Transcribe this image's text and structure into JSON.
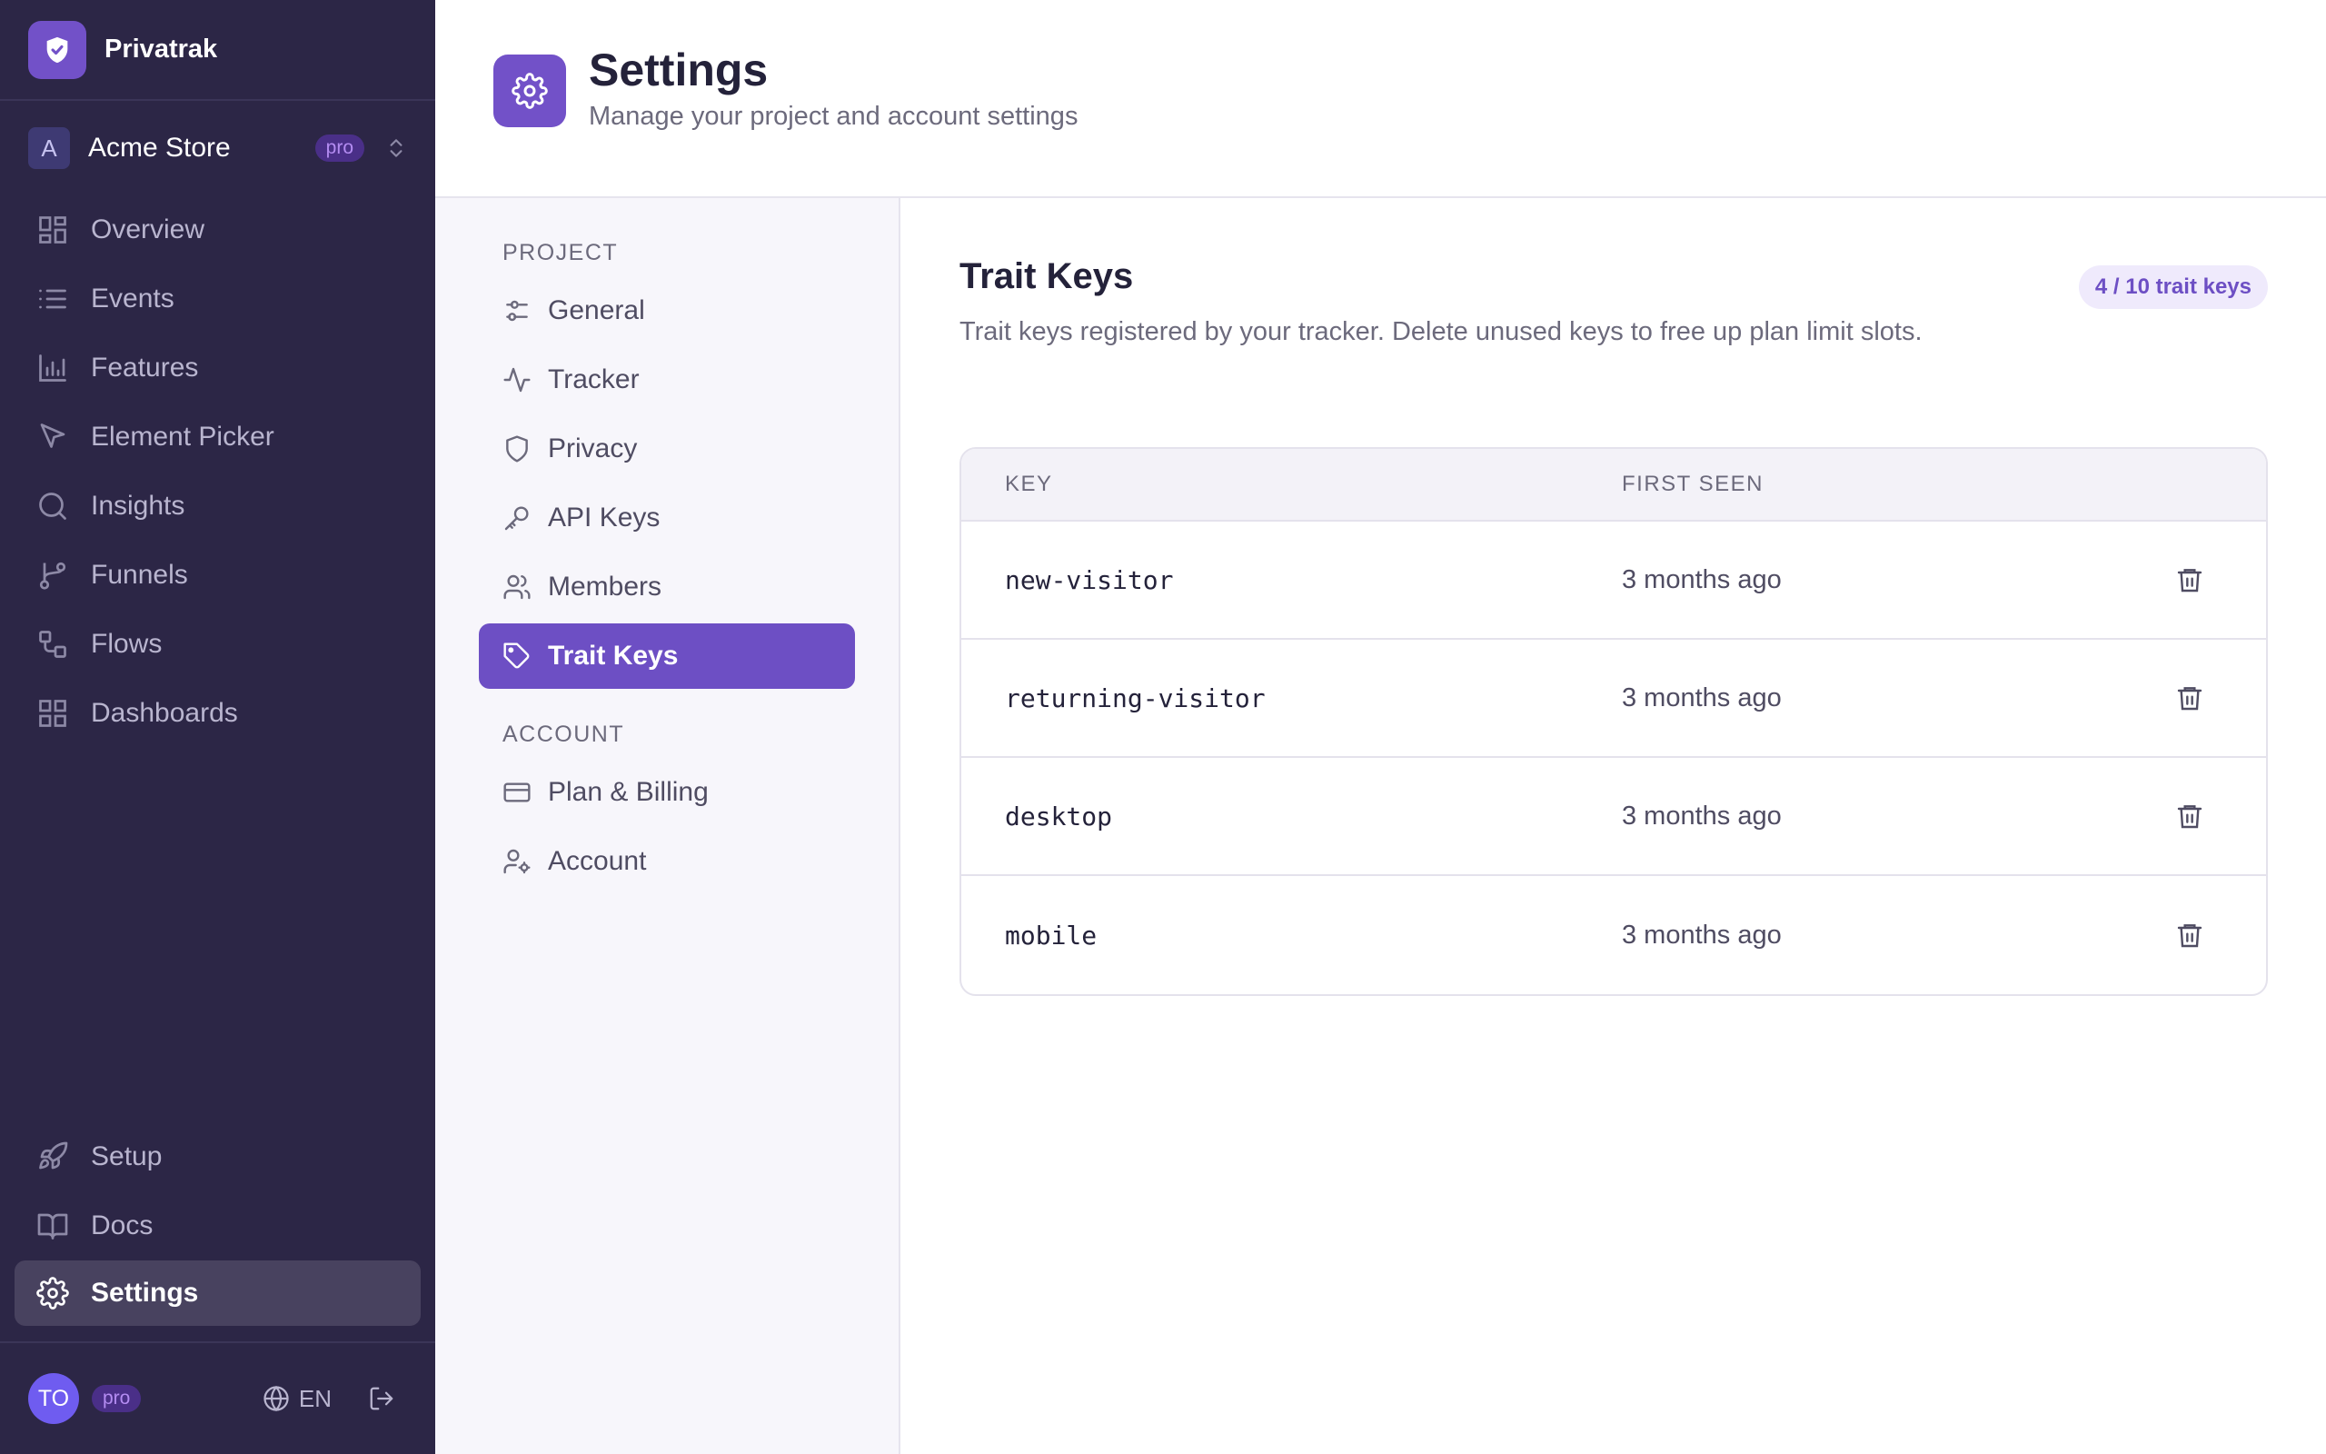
{
  "brand": {
    "name": "Privatrak"
  },
  "project": {
    "avatar": "A",
    "name": "Acme Store",
    "plan": "pro"
  },
  "sidebar": {
    "items": [
      {
        "label": "Overview",
        "icon": "grid-icon"
      },
      {
        "label": "Events",
        "icon": "list-icon"
      },
      {
        "label": "Features",
        "icon": "bar-chart-icon"
      },
      {
        "label": "Element Picker",
        "icon": "cursor-icon"
      },
      {
        "label": "Insights",
        "icon": "search-icon"
      },
      {
        "label": "Funnels",
        "icon": "branch-icon"
      },
      {
        "label": "Flows",
        "icon": "flow-icon"
      },
      {
        "label": "Dashboards",
        "icon": "dashboard-icon"
      }
    ],
    "bottom_items": [
      {
        "label": "Setup",
        "icon": "rocket-icon"
      },
      {
        "label": "Docs",
        "icon": "book-icon"
      },
      {
        "label": "Settings",
        "icon": "gear-icon",
        "active": true
      }
    ]
  },
  "footer": {
    "user_initials": "TO",
    "plan": "pro",
    "language": "EN"
  },
  "header": {
    "title": "Settings",
    "subtitle": "Manage your project and account settings"
  },
  "subnav": {
    "project_label": "PROJECT",
    "project_items": [
      {
        "label": "General",
        "icon": "sliders-icon"
      },
      {
        "label": "Tracker",
        "icon": "activity-icon"
      },
      {
        "label": "Privacy",
        "icon": "shield-icon"
      },
      {
        "label": "API Keys",
        "icon": "key-icon"
      },
      {
        "label": "Members",
        "icon": "users-icon"
      },
      {
        "label": "Trait Keys",
        "icon": "tag-icon",
        "active": true
      }
    ],
    "account_label": "ACCOUNT",
    "account_items": [
      {
        "label": "Plan & Billing",
        "icon": "credit-card-icon"
      },
      {
        "label": "Account",
        "icon": "user-gear-icon"
      }
    ]
  },
  "main": {
    "title": "Trait Keys",
    "description": "Trait keys registered by your tracker. Delete unused keys to free up plan limit slots.",
    "count_badge": "4 / 10 trait keys",
    "columns": {
      "key": "KEY",
      "first_seen": "FIRST SEEN"
    },
    "rows": [
      {
        "key": "new-visitor",
        "first_seen": "3 months ago"
      },
      {
        "key": "returning-visitor",
        "first_seen": "3 months ago"
      },
      {
        "key": "desktop",
        "first_seen": "3 months ago"
      },
      {
        "key": "mobile",
        "first_seen": "3 months ago"
      }
    ]
  },
  "colors": {
    "sidebar_bg": "#2c2646",
    "accent": "#6d4fc4",
    "pill_bg": "#4a2f88",
    "pill_text": "#b48cf2"
  }
}
